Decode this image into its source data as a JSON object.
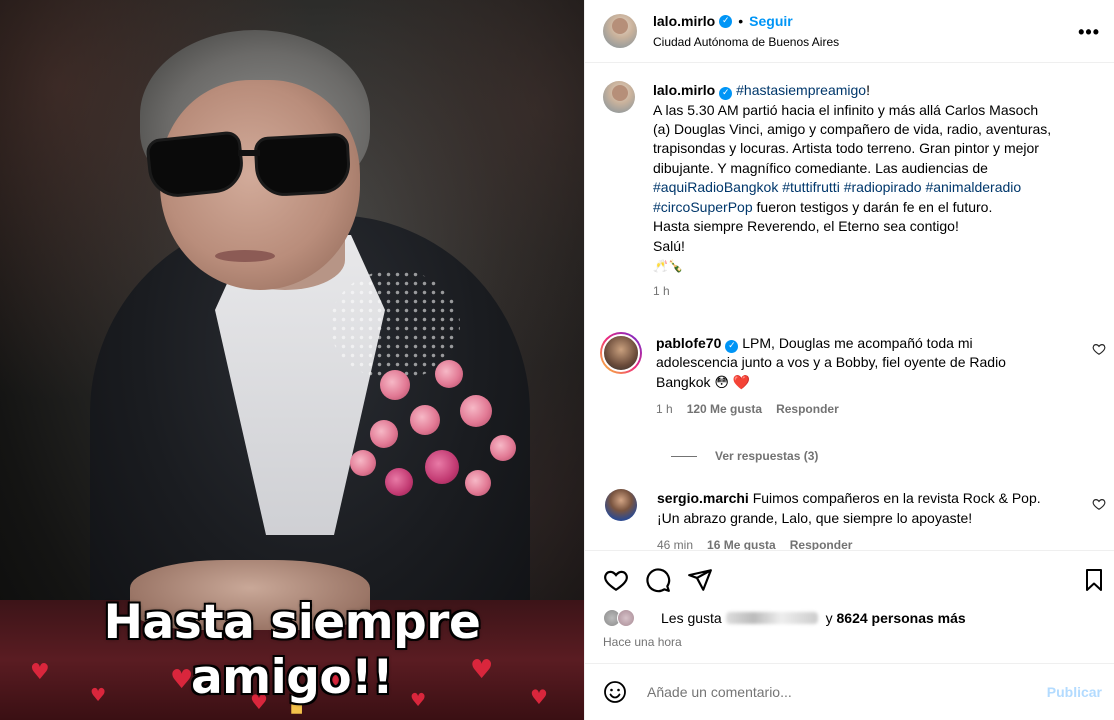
{
  "image": {
    "overlay_text": "Hasta siempre amigo!!"
  },
  "header": {
    "username": "lalo.mirlo",
    "separator": "•",
    "follow_label": "Seguir",
    "location": "Ciudad Autónoma de Buenos Aires",
    "more_label": "•••"
  },
  "caption": {
    "username": "lalo.mirlo",
    "hashtag_title": "#hastasiempreamigo",
    "title_suffix": "!",
    "line_1": "A las 5.30 AM partió hacia el infinito y más allá Carlos Masoch (a) Douglas Vinci, amigo y compañero de vida, radio, aventuras, trapisondas y locuras. Artista todo terreno. Gran pintor y mejor dibujante. Y magnífico comediante. Las audiencias de",
    "tag_1": "#aquiRadioBangkok",
    "tag_2": "#tuttifrutti",
    "tag_3": "#radiopirado",
    "tag_4": "#animalderadio",
    "tag_5": "#circoSuperPop",
    "line_2": " fueron testigos y darán fe en el futuro.",
    "line_3": "Hasta siempre Reverendo, el Eterno sea contigo!",
    "line_4": "Salú!",
    "emoji": "🥂🍾",
    "time": "1 h"
  },
  "comments": [
    {
      "username": "pablofe70",
      "text": "LPM, Douglas me acompañó toda mi adolescencia junto a vos y a Bobby, fiel oyente de Radio Bangkok 😳 ❤️",
      "time": "1 h",
      "likes": "120 Me gusta",
      "reply": "Responder",
      "view_replies": "Ver respuestas (3)"
    },
    {
      "username": "sergio.marchi",
      "text": "Fuimos compañeros en la revista Rock & Pop. ¡Un abrazo grande, Lalo, que siempre lo apoyaste!",
      "time": "46 min",
      "likes": "16 Me gusta",
      "reply": "Responder"
    }
  ],
  "likes": {
    "prefix": "Les gusta",
    "suffix": " y ",
    "count": "8624 personas más"
  },
  "post_time": "Hace una hora",
  "add_comment": {
    "placeholder": "Añade un comentario...",
    "post_label": "Publicar"
  },
  "colors": {
    "accent": "#0095f6",
    "hashtag": "#00376b",
    "muted": "#737373",
    "post_disabled": "#b3dbff"
  }
}
